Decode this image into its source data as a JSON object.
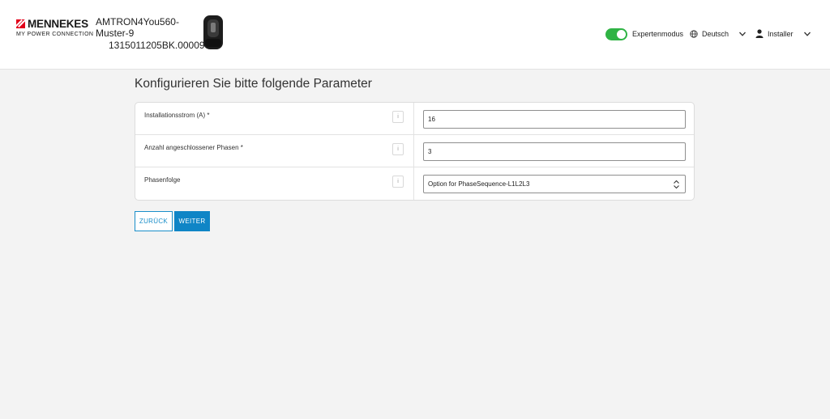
{
  "header": {
    "brand": "MENNEKES",
    "tagline": "MY POWER CONNECTION",
    "device_name": "AMTRON4You560-Muster-9",
    "device_serial": "1315011205BK.00009",
    "expert_mode_label": "Expertenmodus",
    "expert_mode_on": true,
    "language": "Deutsch",
    "user": "Installer"
  },
  "main": {
    "title": "Konfigurieren Sie bitte folgende Parameter",
    "fields": [
      {
        "label": "Installationsstrom (A) *",
        "value": "16",
        "info": "i"
      },
      {
        "label": "Anzahl angeschlossener Phasen *",
        "value": "3",
        "info": "i"
      },
      {
        "label": "Phasenfolge",
        "value": "Option for PhaseSequence-L1L2L3",
        "info": "i"
      }
    ],
    "back_label": "ZURÜCK",
    "next_label": "WEITER"
  },
  "colors": {
    "brand_red": "#e2001a",
    "toggle_green": "#2fb344",
    "accent_blue": "#0f85c6"
  }
}
